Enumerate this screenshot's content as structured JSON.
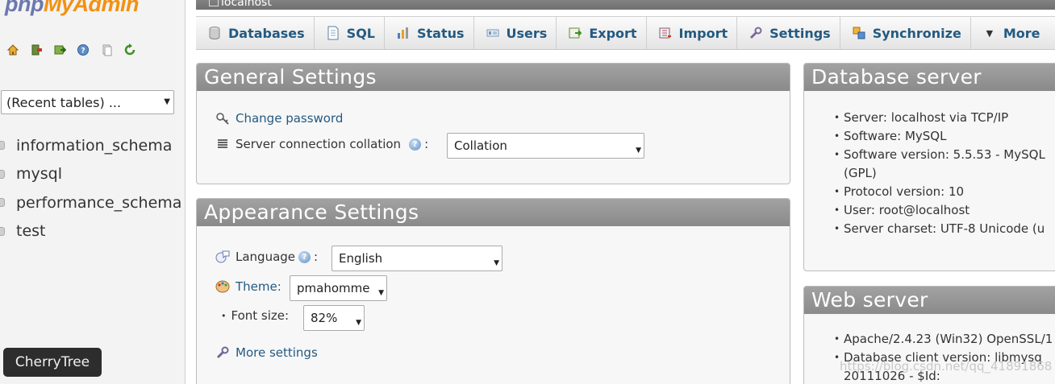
{
  "nav": {
    "logo": {
      "php": "php",
      "my": "My",
      "admin": "Admin"
    },
    "icons": [
      "home-icon",
      "exit-icon",
      "query-window-icon",
      "docs-icon",
      "copy-icon",
      "reload-icon"
    ],
    "recent_tables": "(Recent tables) ...",
    "databases": [
      "information_schema",
      "mysql",
      "performance_schema",
      "test"
    ]
  },
  "taskbar": {
    "cherrytree": "CherryTree"
  },
  "serverbar": {
    "label": "localhost"
  },
  "tabs": [
    {
      "label": "Databases",
      "icon": "database-icon"
    },
    {
      "label": "SQL",
      "icon": "sql-icon"
    },
    {
      "label": "Status",
      "icon": "status-icon"
    },
    {
      "label": "Users",
      "icon": "users-icon"
    },
    {
      "label": "Export",
      "icon": "export-icon"
    },
    {
      "label": "Import",
      "icon": "import-icon"
    },
    {
      "label": "Settings",
      "icon": "wrench-icon"
    },
    {
      "label": "Synchronize",
      "icon": "synchronize-icon"
    },
    {
      "label": "More",
      "icon": "triangle-down-icon"
    }
  ],
  "general": {
    "title": "General Settings",
    "change_password": "Change password",
    "collation_label": "Server connection collation",
    "collation_value": "Collation"
  },
  "appearance": {
    "title": "Appearance Settings",
    "language_label": "Language",
    "language_value": "English",
    "theme_label": "Theme:",
    "theme_value": "pmahomme",
    "fontsize_label": "Font size:",
    "fontsize_value": "82%",
    "more_settings": "More settings"
  },
  "dbserver": {
    "title": "Database server",
    "items": [
      "Server: localhost via TCP/IP",
      "Software: MySQL",
      "Software version: 5.5.53 - MySQL",
      "(GPL)",
      "Protocol version: 10",
      "User: root@localhost",
      "Server charset: UTF-8 Unicode (u"
    ]
  },
  "webserver": {
    "title": "Web server",
    "items": [
      "Apache/2.4.23 (Win32) OpenSSL/1",
      "Database client version: libmysq",
      "20111026 - $Id:"
    ]
  },
  "watermark": "https://blog.csdn.net/qq_41891868"
}
